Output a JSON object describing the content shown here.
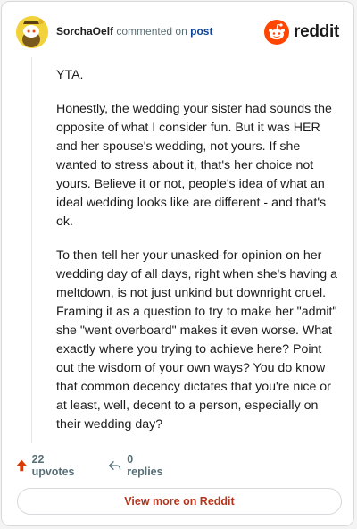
{
  "header": {
    "username": "SorchaOelf",
    "commented_on": "commented on",
    "post_link": "post",
    "brand": "reddit"
  },
  "comment": {
    "paragraphs": [
      "YTA.",
      "Honestly, the wedding your sister had sounds the opposite of what I consider fun. But it was HER and her spouse's wedding, not yours. If she wanted to stress about it, that's her choice not yours. Believe it or not, people's idea of what an ideal wedding looks like are different - and that's ok.",
      "To then tell her your unasked-for opinion on her wedding day of all days, right when she's having a meltdown, is not just unkind but downright cruel. Framing it as a question to try to make her \"admit\" she \"went overboard\" makes it even worse. What exactly where you trying to achieve here? Point out the wisdom of your own ways? You do know that common decency dictates that you're nice or at least, well, decent to a person, especially on their wedding day?"
    ]
  },
  "actions": {
    "upvotes": "22 upvotes",
    "replies": "0 replies"
  },
  "footer": {
    "view_more": "View more on Reddit"
  },
  "colors": {
    "upvote": "#d93a00",
    "reddit_orange": "#ff4500",
    "link": "#0a449b",
    "view_more": "#b3351b"
  }
}
